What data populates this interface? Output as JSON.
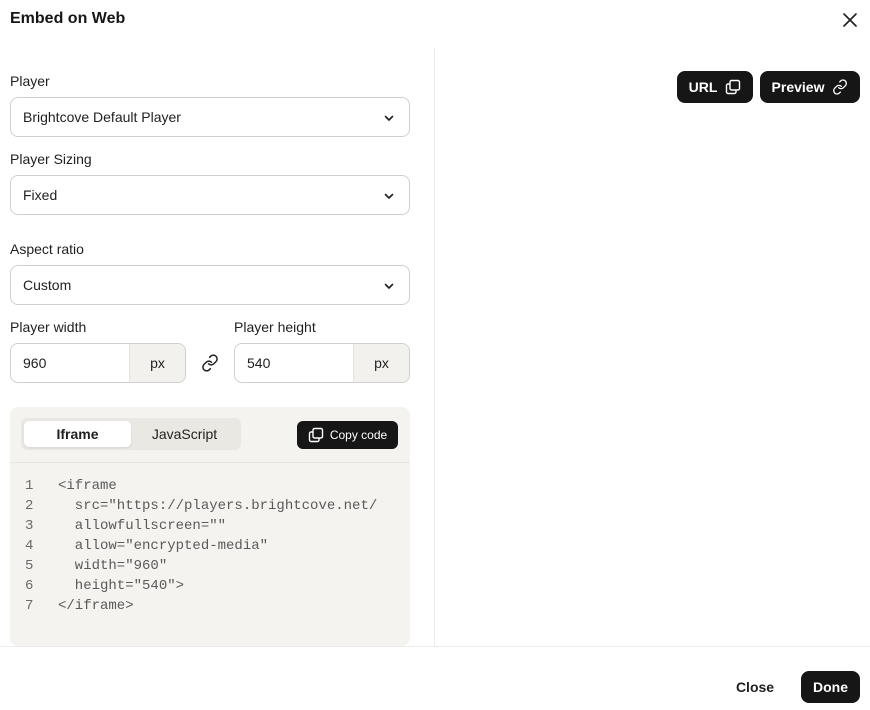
{
  "dialog": {
    "title": "Embed on Web"
  },
  "player": {
    "label": "Player",
    "value": "Brightcove Default Player"
  },
  "sizing": {
    "label": "Player Sizing",
    "value": "Fixed"
  },
  "aspect": {
    "label": "Aspect ratio",
    "value": "Custom"
  },
  "dimensions": {
    "width_label": "Player width",
    "width_value": "960",
    "width_unit": "px",
    "height_label": "Player height",
    "height_value": "540",
    "height_unit": "px"
  },
  "code": {
    "tabs": [
      {
        "label": "Iframe",
        "active": true
      },
      {
        "label": "JavaScript",
        "active": false
      }
    ],
    "copy_label": "Copy code",
    "lines": [
      {
        "n": "1",
        "text": "<iframe"
      },
      {
        "n": "2",
        "text": "  src=\"https://players.brightcove.net/"
      },
      {
        "n": "3",
        "text": "  allowfullscreen=\"\""
      },
      {
        "n": "4",
        "text": "  allow=\"encrypted-media\""
      },
      {
        "n": "5",
        "text": "  width=\"960\""
      },
      {
        "n": "6",
        "text": "  height=\"540\">"
      },
      {
        "n": "7",
        "text": "</iframe>"
      }
    ]
  },
  "preview_actions": {
    "url_label": "URL",
    "preview_label": "Preview"
  },
  "footer": {
    "close_label": "Close",
    "done_label": "Done"
  },
  "icons": {
    "close": "close-icon",
    "chevron": "chevron-down-icon",
    "link": "link-icon",
    "copy": "copy-icon"
  },
  "colors": {
    "primary_dark": "#161616",
    "code_bg": "#f4f3ef",
    "border": "#cfcfcf"
  }
}
